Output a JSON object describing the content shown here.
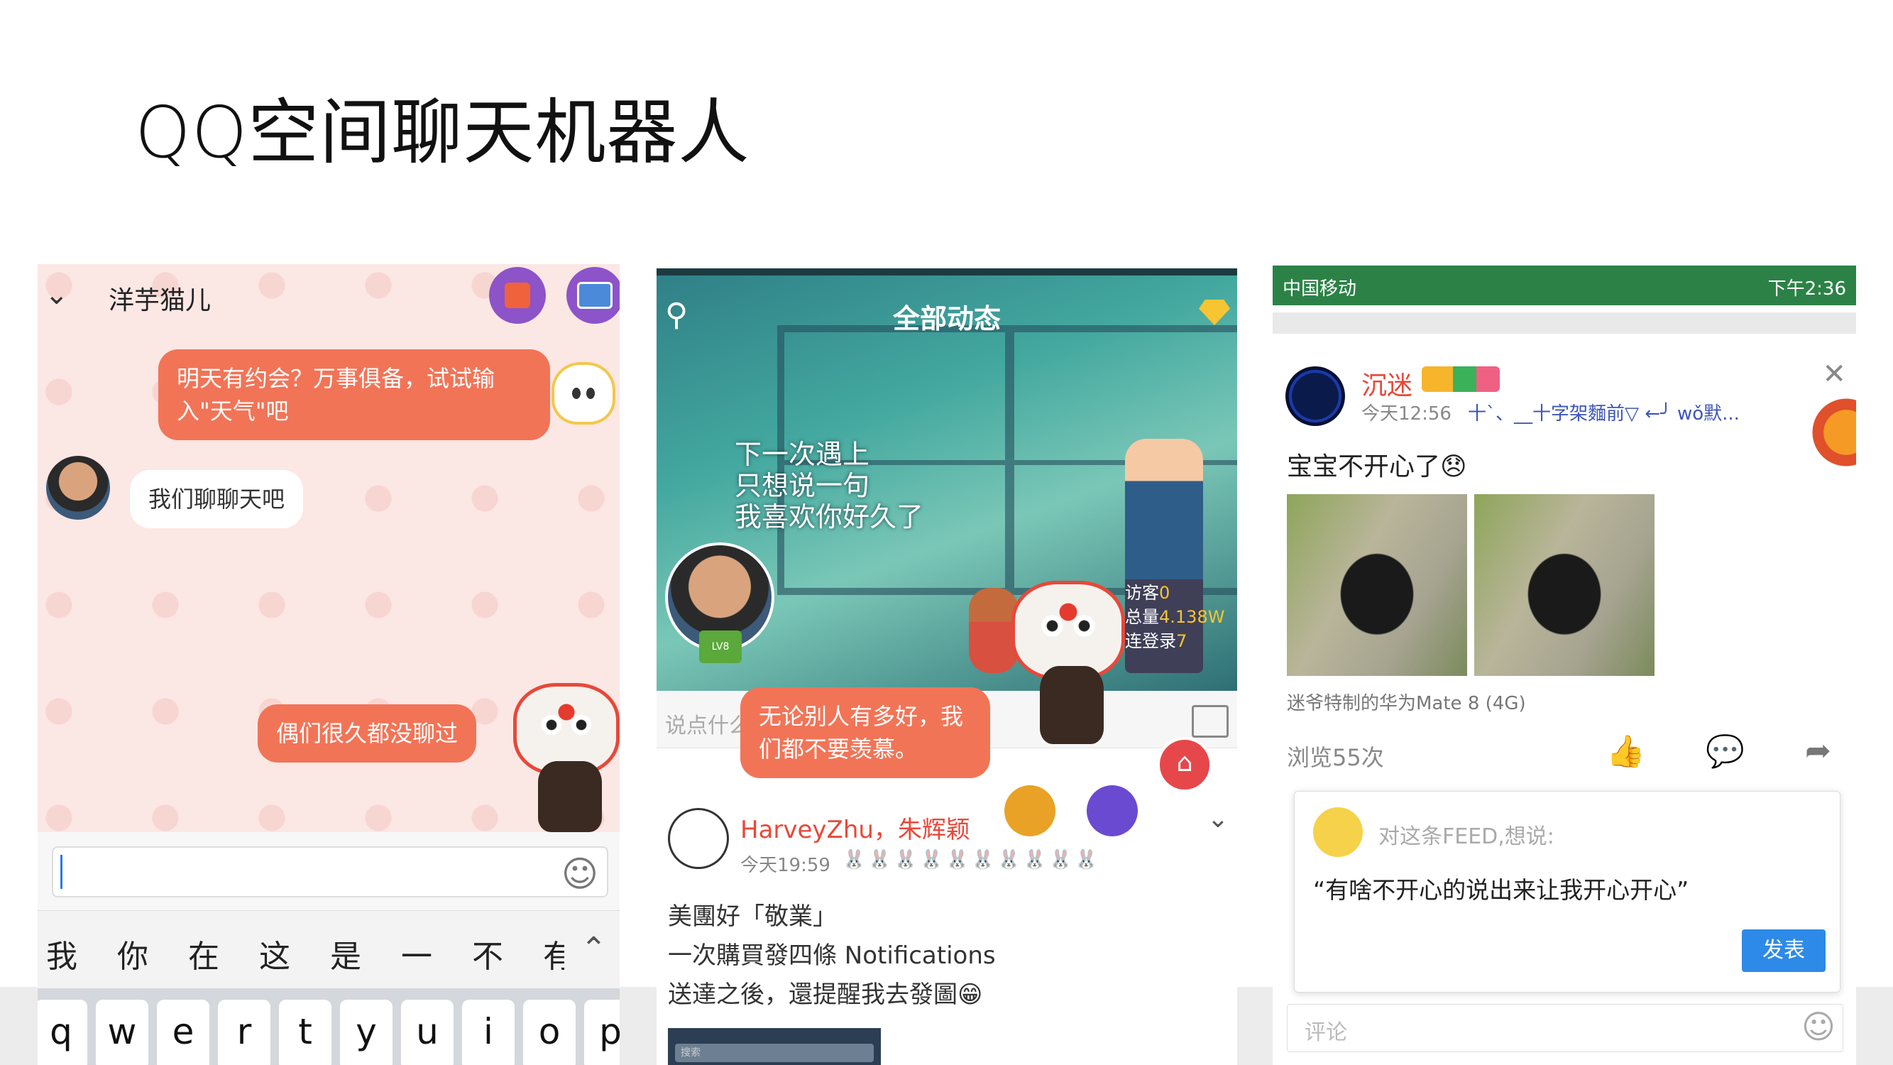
{
  "slide": {
    "title": "QQ空间聊天机器人"
  },
  "phone1": {
    "contact_name": "洋芋猫儿",
    "bubble_bot_1": "明天有约会？万事俱备，试试输入\"天气\"吧",
    "bubble_user": "我们聊聊天吧",
    "bubble_bot_2": "偶们很久都没聊过",
    "candidates": [
      "我",
      "你",
      "在",
      "这",
      "是",
      "一",
      "不",
      "有"
    ],
    "keys": [
      "q",
      "w",
      "e",
      "r",
      "t",
      "y",
      "u",
      "i",
      "o",
      "p"
    ]
  },
  "phone2": {
    "title": "全部动态",
    "banner_quote": "下一次遇上\n只想说一句\n我喜欢你好久了",
    "stats": {
      "visitors_label": "访客",
      "visitors": "0",
      "total_label": "总量",
      "total": "4.138W",
      "login_label": "连登录",
      "login": "7"
    },
    "badge": "LV8",
    "post_placeholder": "说点什么",
    "bot_bubble": "无论别人有多好，我们都不要羡慕。",
    "feed_name": "HarveyZhu，朱辉颖",
    "feed_time": "今天19:59",
    "feed_rabbits": "🐰🐰🐰🐰🐰🐰🐰🐰🐰🐰",
    "feed_line1": "美團好「敬業」",
    "feed_line2": "一次購買發四條 Notifications",
    "feed_line3": "送達之後，還提醒我去發圖😁",
    "screenshot_search": "搜索"
  },
  "phone3": {
    "carrier": "中国移动",
    "status_right": "下午2:36",
    "name": "沉迷",
    "time": "今天12:56",
    "signature": "十`、__十字架麵前▽ ←╯ wǒ默...",
    "text": "宝宝不开心了😞",
    "device": "迷爷特制的华为Mate 8 (4G)",
    "views": "浏览55次",
    "popup_placeholder": "对这条FEED,想说:",
    "popup_text": "“有啥不开心的说出来让我开心开心”",
    "send_button": "发表",
    "comment_placeholder": "评论"
  }
}
